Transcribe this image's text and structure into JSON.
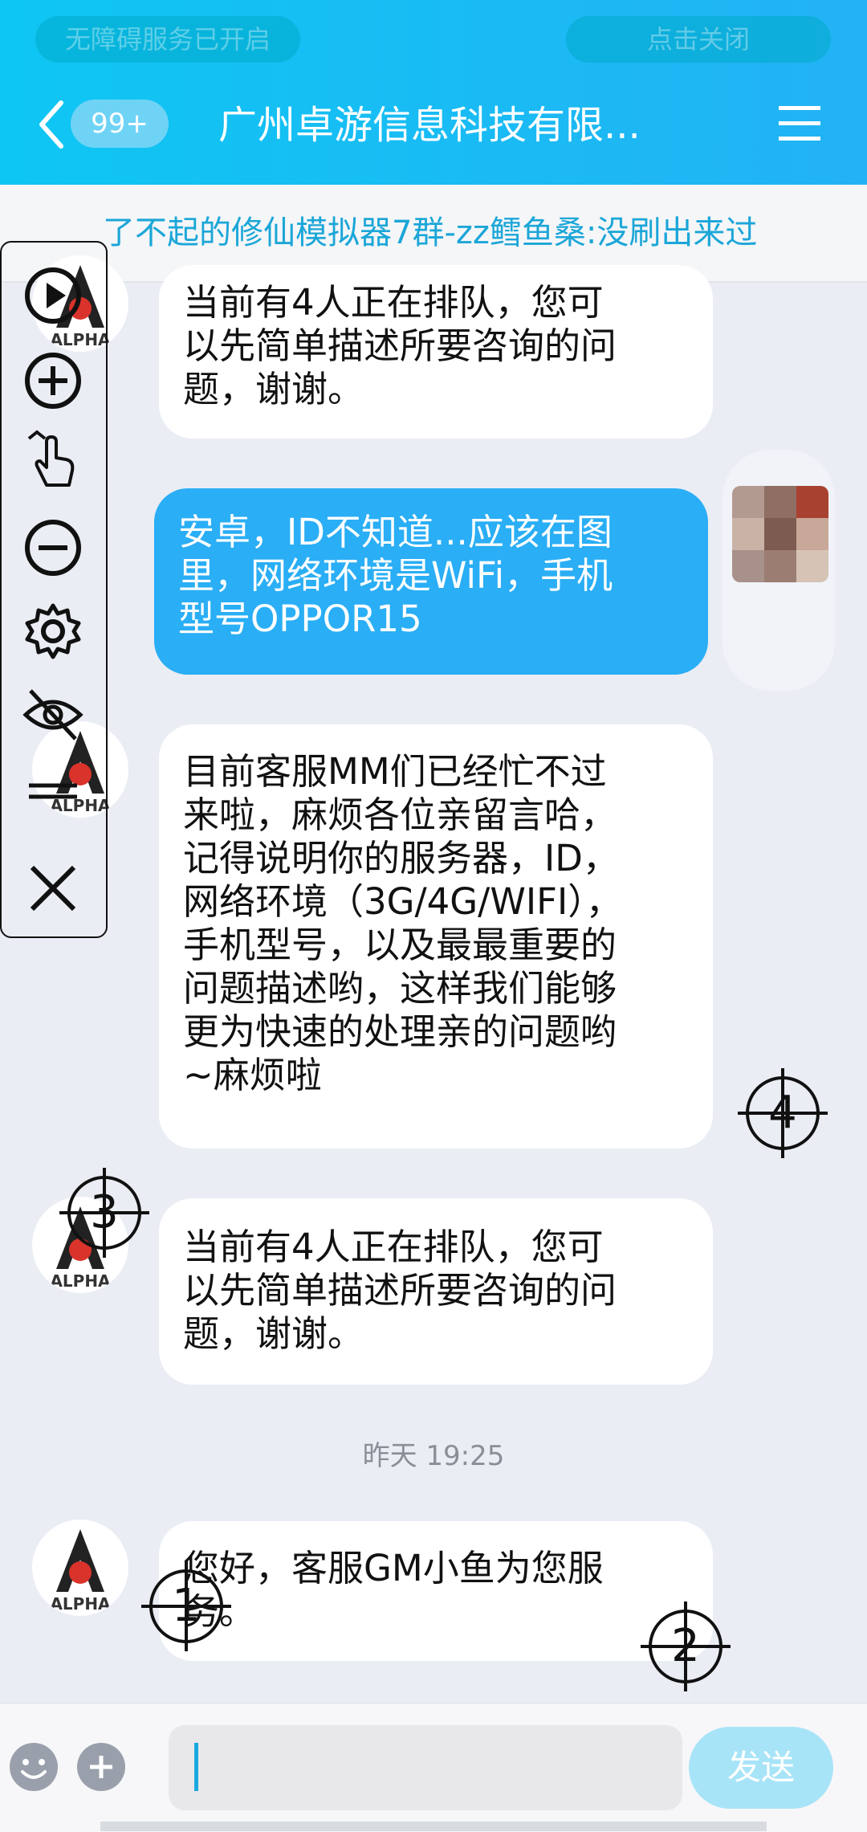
{
  "accessibility_bar": {
    "left_text": "无障碍服务已开启",
    "right_text": "点击关闭"
  },
  "header": {
    "unread_badge": "99+",
    "title": "广州卓游信息科技有限..."
  },
  "notice": {
    "text": "了不起的修仙模拟器7群-zz鳕鱼桑:没刷出来过"
  },
  "messages": [
    {
      "from": "agent",
      "lines": [
        "当前有4人正在排队，您可",
        "以先简单描述所要咨询的问",
        "题，谢谢。"
      ]
    },
    {
      "from": "user",
      "lines": [
        "安卓，ID不知道...应该在图",
        "里，网络环境是WiFi，手机",
        "型号OPPOR15"
      ]
    },
    {
      "from": "agent",
      "lines": [
        "目前客服MM们已经忙不过",
        "来啦，麻烦各位亲留言哈，",
        "记得说明你的服务器，ID，",
        "网络环境（3G/4G/WIFI），",
        "手机型号，以及最最重要的",
        "问题描述哟，这样我们能够",
        "更为快速的处理亲的问题哟",
        "~麻烦啦"
      ]
    },
    {
      "from": "agent",
      "lines": [
        "当前有4人正在排队，您可",
        "以先简单描述所要咨询的问",
        "题，谢谢。"
      ]
    },
    {
      "from": "agent",
      "lines": [
        "您好，客服GM小鱼为您服",
        "务。"
      ]
    }
  ],
  "timestamp": "昨天 19:25",
  "avatar_logo_text": "ALPHA",
  "targets": [
    "1",
    "2",
    "3",
    "4"
  ],
  "input": {
    "placeholder": "",
    "send_label": "发送"
  },
  "colors": {
    "header_start": "#0ec6f3",
    "header_end": "#23b2f4",
    "user_bubble": "#2aaef5",
    "notice_text": "#1ba6d8",
    "send_button": "#a8e4f8"
  }
}
